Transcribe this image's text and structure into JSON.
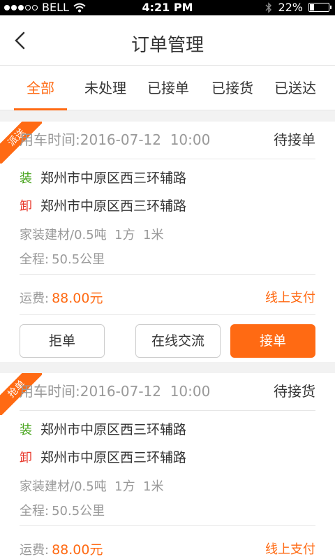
{
  "status_bar": {
    "carrier": "BELL",
    "time": "4:21 PM",
    "battery": "22%",
    "battery_level": 0.22,
    "signal_bars": 3
  },
  "nav": {
    "back_icon": "chevron-left-icon",
    "title": "订单管理"
  },
  "tabs": [
    {
      "label": "全部",
      "active": true
    },
    {
      "label": "未处理"
    },
    {
      "label": "已接单"
    },
    {
      "label": "已接货"
    },
    {
      "label": "已送达"
    }
  ],
  "colors": {
    "accent": "#ff6a13",
    "load_tag": "#49a51f",
    "unload_tag": "#e8382b"
  },
  "orders": [
    {
      "ribbon": "派送",
      "time_label": "用车时间:",
      "time_value": "2016-07-12  10:00",
      "status": "待接单",
      "load_tag": "装",
      "load_addr": "郑州市中原区西三环辅路",
      "unload_tag": "卸",
      "unload_addr": "郑州市中原区西三环辅路",
      "goods": "家装建材/0.5吨  1方  1米",
      "distance_label": "全程:",
      "distance_value": "50.5公里",
      "fee_label": "运费:",
      "fee_value": "88.00元",
      "payment": "线上支付",
      "buttons": {
        "reject": "拒单",
        "chat": "在线交流",
        "accept": "接单"
      }
    },
    {
      "ribbon": "抢单",
      "time_label": "用车时间:",
      "time_value": "2016-07-12  10:00",
      "status": "待接货",
      "load_tag": "装",
      "load_addr": "郑州市中原区西三环辅路",
      "unload_tag": "卸",
      "unload_addr": "郑州市中原区西三环辅路",
      "goods": "家装建材/0.5吨  1方  1米",
      "distance_label": "全程:",
      "distance_value": "50.5公里",
      "fee_label": "运费:",
      "fee_value": "88.00元",
      "payment": "线上支付"
    }
  ]
}
